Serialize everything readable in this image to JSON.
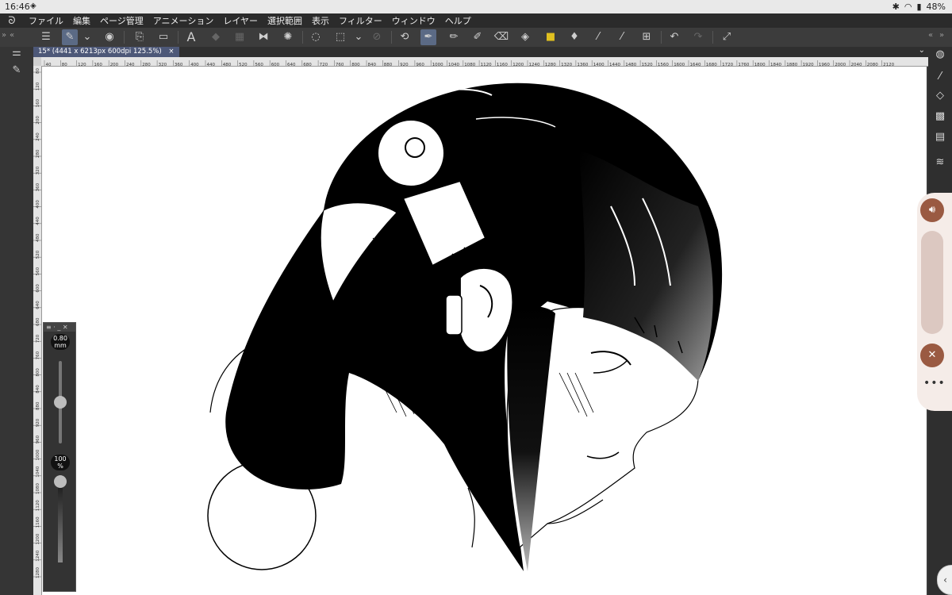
{
  "status_bar": {
    "time": "16:46",
    "notification_icon": "game-controller-icon",
    "battery": "48%"
  },
  "menu": {
    "items": [
      "ファイル",
      "編集",
      "ページ管理",
      "アニメーション",
      "レイヤー",
      "選択範囲",
      "表示",
      "フィルター",
      "ウィンドウ",
      "ヘルプ"
    ]
  },
  "document_tab": {
    "title": "15* (4441 x 6213px 600dpi 125.5%)",
    "close": "×"
  },
  "ruler": {
    "h_labels": [
      "40",
      "80",
      "120",
      "160",
      "200",
      "240",
      "280",
      "320",
      "360",
      "400",
      "440",
      "480",
      "520",
      "560",
      "600",
      "640",
      "680",
      "720",
      "760",
      "800",
      "840",
      "880",
      "920",
      "960",
      "1000",
      "1040",
      "1080",
      "1120",
      "1160",
      "1200",
      "1240",
      "1280",
      "1320",
      "1360",
      "1400",
      "1440",
      "1480",
      "1520",
      "1560",
      "1600",
      "1640",
      "1680",
      "1720",
      "1760",
      "1800",
      "1840",
      "1880",
      "1920",
      "1960",
      "2000",
      "2040",
      "2080",
      "2120"
    ],
    "v_labels": [
      "80",
      "120",
      "160",
      "200",
      "240",
      "280",
      "320",
      "360",
      "400",
      "440",
      "480",
      "520",
      "560",
      "600",
      "640",
      "680",
      "720",
      "760",
      "800",
      "840",
      "880",
      "920",
      "960",
      "1000",
      "1040",
      "1080",
      "1120",
      "1160",
      "1200",
      "1240",
      "1280"
    ]
  },
  "brush_widget": {
    "size_value": "0.80",
    "size_unit": "mm",
    "opacity_value": "100",
    "opacity_unit": "%",
    "size_level": 0.5,
    "opacity_level": 1.0
  },
  "toolbar": {
    "icons": [
      "menu-icon",
      "layer-edit-icon",
      "chevron-down-icon",
      "navigator-icon",
      "new-document-icon",
      "open-file-icon",
      "text-tool-icon",
      "fill-icon",
      "grid-icon",
      "flip-icon",
      "loading-icon",
      "lasso-icon",
      "selection-icon",
      "chevron-down-icon",
      "crop-icon",
      "transform-icon",
      "pen-icon",
      "pencil-icon",
      "marker-icon",
      "eraser-icon",
      "bucket-icon",
      "sticker-icon",
      "droplet-icon",
      "eyedropper-icon",
      "eyedropper-icon",
      "ruler-icon",
      "undo-icon",
      "redo-icon",
      "fullscreen-icon"
    ]
  },
  "colors": {
    "accent": "#5b6a85",
    "overlay_button": "#9a5a42"
  }
}
